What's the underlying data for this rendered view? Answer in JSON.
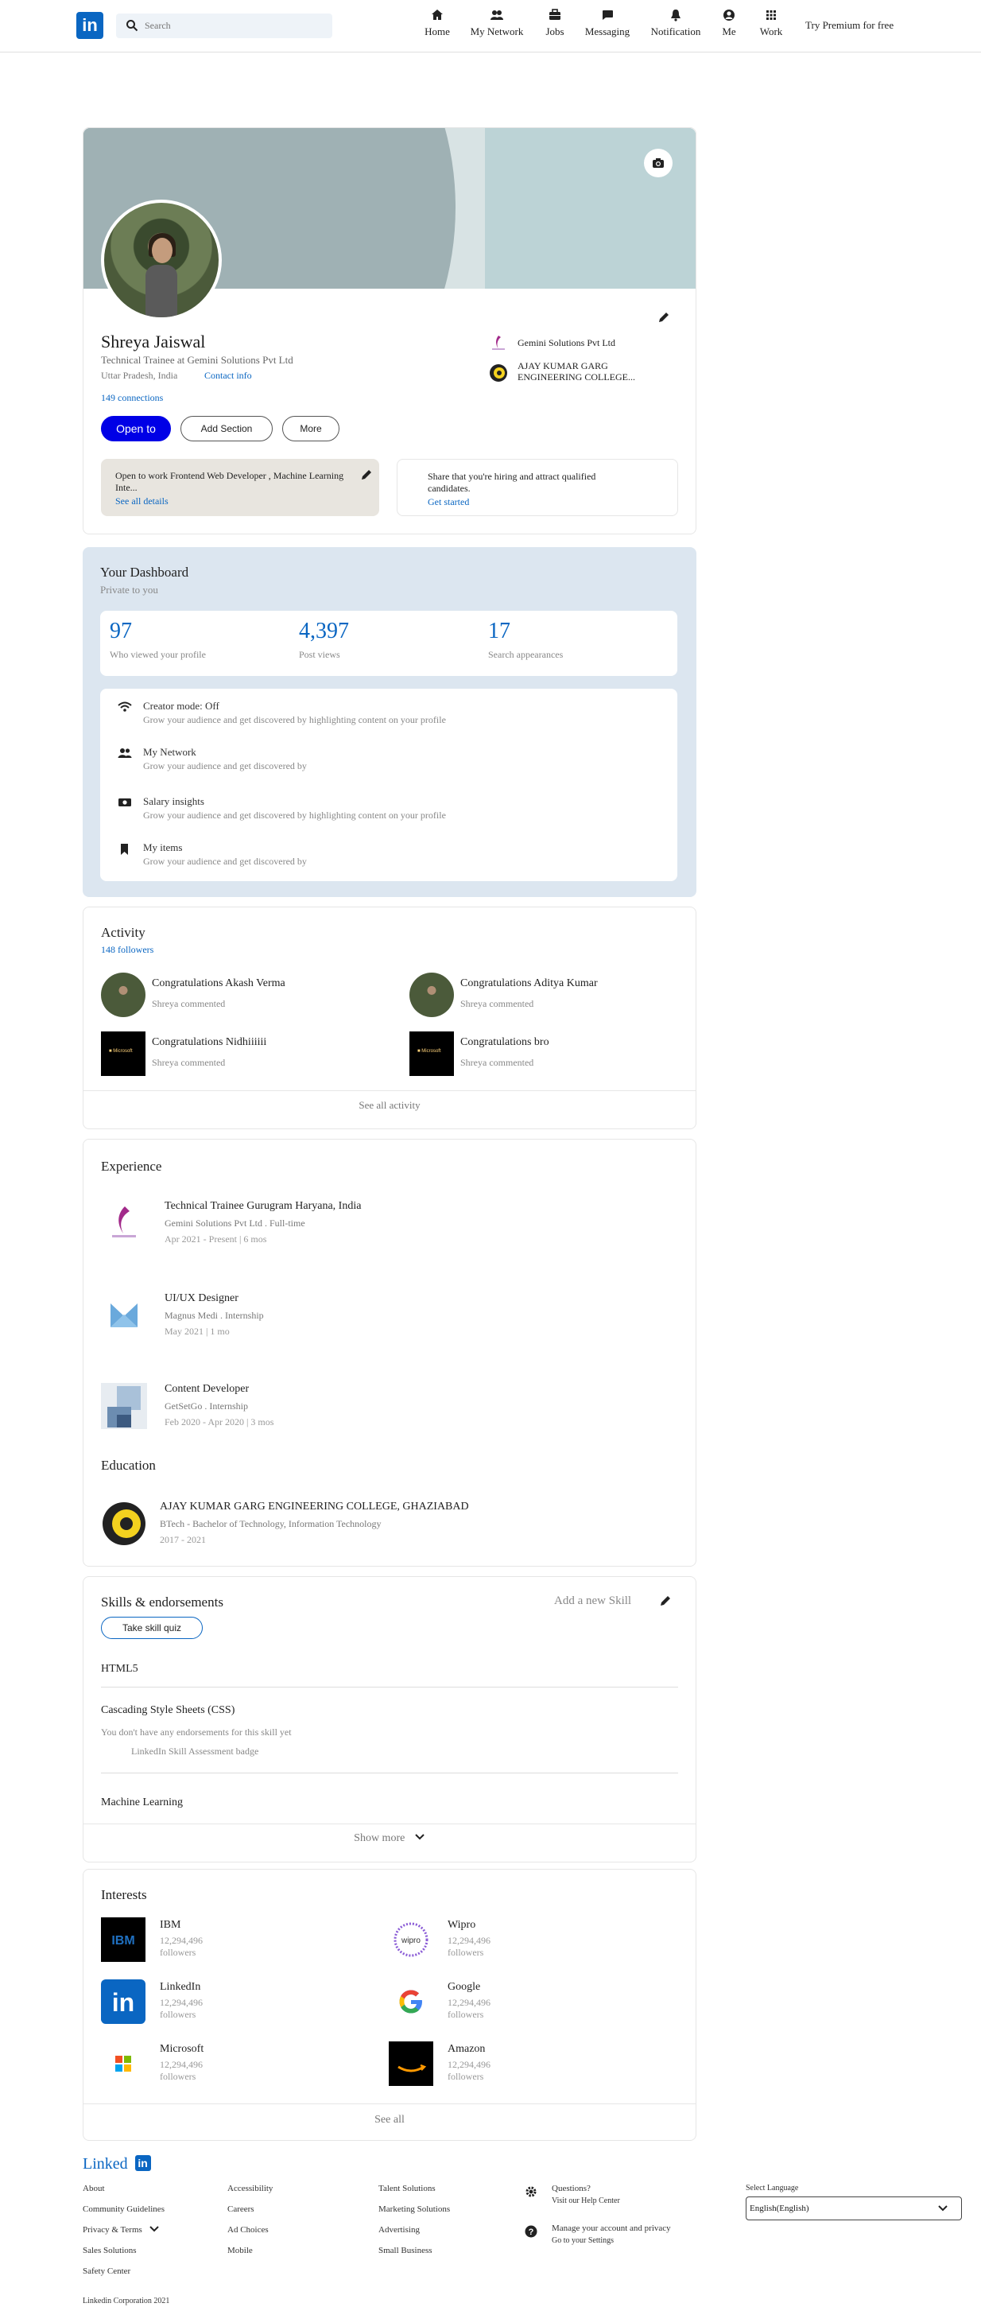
{
  "nav": {
    "search_placeholder": "Search",
    "items": [
      {
        "label": "Home",
        "icon": "home-icon"
      },
      {
        "label": "My Network",
        "icon": "network-icon"
      },
      {
        "label": "Jobs",
        "icon": "briefcase-icon"
      },
      {
        "label": "Messaging",
        "icon": "message-icon"
      },
      {
        "label": "Notification",
        "icon": "bell-icon"
      },
      {
        "label": "Me",
        "icon": "user-icon"
      },
      {
        "label": "Work",
        "icon": "grid-icon"
      }
    ],
    "premium": "Try Premium for free"
  },
  "profile": {
    "name": "Shreya Jaiswal",
    "headline": "Technical Trainee at Gemini Solutions Pvt Ltd",
    "location": "Uttar Pradesh, India",
    "contact_info": "Contact info",
    "connections": "149 connections",
    "open_to": "Open to",
    "add_section": "Add Section",
    "more": "More",
    "companies": [
      {
        "name": "Gemini Solutions Pvt Ltd"
      },
      {
        "name": "AJAY KUMAR GARG ENGINEERING COLLEGE..."
      }
    ],
    "open_card_text": "Open to work Frontend Web Developer , Machine Learning Inte...",
    "see_all_details": "See all details",
    "hiring_text": "Share that you're hiring and attract qualified candidates.",
    "get_started": "Get started"
  },
  "dashboard": {
    "title": "Your Dashboard",
    "subtitle": "Private to you",
    "stats": [
      {
        "value": "97",
        "label": "Who viewed your profile"
      },
      {
        "value": "4,397",
        "label": "Post views"
      },
      {
        "value": "17",
        "label": "Search appearances"
      }
    ],
    "items": [
      {
        "title": "Creator mode: Off",
        "desc": "Grow your audience and get discovered by highlighting content on your profile",
        "icon": "wifi-icon"
      },
      {
        "title": "My Network",
        "desc": "Grow your audience and get discovered by",
        "icon": "people-icon"
      },
      {
        "title": "Salary insights",
        "desc": "Grow your audience and get discovered by highlighting content on your profile",
        "icon": "money-icon"
      },
      {
        "title": "My items",
        "desc": "Grow your audience and get discovered by",
        "icon": "bookmark-icon"
      }
    ]
  },
  "activity": {
    "title": "Activity",
    "followers": "148 followers",
    "items": [
      {
        "title": "Congratulations Akash Verma",
        "sub": "Shreya commented"
      },
      {
        "title": "Congratulations Aditya Kumar",
        "sub": "Shreya commented"
      },
      {
        "title": "Congratulations Nidhiiiiii",
        "sub": "Shreya commented"
      },
      {
        "title": "Congratulations bro",
        "sub": "Shreya commented"
      }
    ],
    "see_all": "See all activity"
  },
  "experience": {
    "title": "Experience",
    "items": [
      {
        "title": "Technical Trainee Gurugram Haryana, India",
        "company": "Gemini Solutions Pvt Ltd . Full-time",
        "dates": "Apr 2021 - Present | 6 mos"
      },
      {
        "title": "UI/UX Designer",
        "company": "Magnus Medi . Internship",
        "dates": "May 2021 | 1 mo"
      },
      {
        "title": "Content Developer",
        "company": "GetSetGo . Internship",
        "dates": "Feb 2020 - Apr 2020 | 3 mos"
      }
    ]
  },
  "education": {
    "title": "Education",
    "items": [
      {
        "school": "AJAY KUMAR GARG ENGINEERING COLLEGE, GHAZIABAD",
        "degree": "BTech - Bachelor of Technology, Information Technology",
        "years": "2017 - 2021"
      }
    ]
  },
  "skills": {
    "title": "Skills & endorsements",
    "add_new": "Add a new Skill",
    "quiz": "Take skill quiz",
    "items": [
      "HTML5",
      "Cascading Style Sheets (CSS)",
      "Machine Learning"
    ],
    "no_endorse": "You don't have any endorsements for this skill yet",
    "badge": "LinkedIn Skill Assessment badge",
    "show_more": "Show more"
  },
  "interests": {
    "title": "Interests",
    "items": [
      {
        "name": "IBM",
        "followers": "12,294,496 followers"
      },
      {
        "name": "Wipro",
        "followers": "12,294,496 followers"
      },
      {
        "name": "LinkedIn",
        "followers": "12,294,496 followers"
      },
      {
        "name": "Google",
        "followers": "12,294,496 followers"
      },
      {
        "name": "Microsoft",
        "followers": "12,294,496 followers"
      },
      {
        "name": "Amazon",
        "followers": "12,294,496 followers"
      }
    ],
    "see_all": "See all"
  },
  "footer": {
    "brand": "Linked",
    "col1": [
      "About",
      "Community Guidelines",
      "Privacy & Terms",
      "Sales Solutions",
      "Safety Center"
    ],
    "col2": [
      "Accessibility",
      "Careers",
      "Ad Choices",
      "Mobile"
    ],
    "col3": [
      "Talent Solutions",
      "Marketing Solutions",
      "Advertising",
      "Small Business"
    ],
    "questions": "Questions?",
    "help": "Visit our Help Center",
    "manage": "Manage your account and privacy",
    "settings": "Go to your Settings",
    "select_language": "Select Language",
    "language_value": "English(English)",
    "copyright": "Linkedin Corporation 2021"
  },
  "colors": {
    "brand": "#0a66c2",
    "open_to_button": "#0000e6",
    "dashboard_bg": "#dce6f0"
  }
}
